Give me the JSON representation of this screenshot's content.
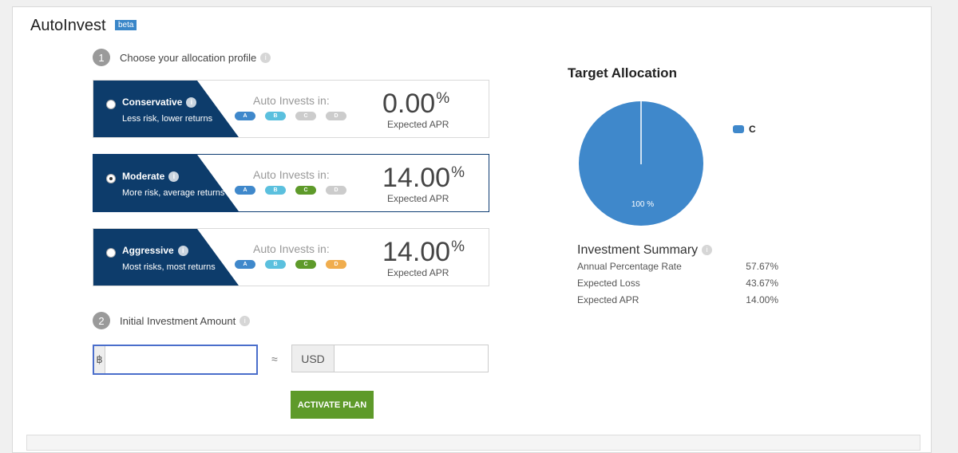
{
  "header": {
    "title": "AutoInvest",
    "badge": "beta"
  },
  "step1": {
    "num": "1",
    "label": "Choose your allocation profile"
  },
  "profiles": [
    {
      "name": "Conservative",
      "desc": "Less risk, lower returns",
      "selected": false,
      "auto_label": "Auto Invests in:",
      "pills": [
        "A",
        "B",
        "C",
        "D"
      ],
      "pct": "0.00",
      "pct_sym": "%",
      "apr_label": "Expected APR"
    },
    {
      "name": "Moderate",
      "desc": "More risk, average returns",
      "selected": true,
      "auto_label": "Auto Invests in:",
      "pills": [
        "A",
        "B",
        "C",
        "D"
      ],
      "pct": "14.00",
      "pct_sym": "%",
      "apr_label": "Expected APR"
    },
    {
      "name": "Aggressive",
      "desc": "Most risks, most returns",
      "selected": false,
      "auto_label": "Auto Invests in:",
      "pills": [
        "A",
        "B",
        "C",
        "D"
      ],
      "pct": "14.00",
      "pct_sym": "%",
      "apr_label": "Expected APR"
    }
  ],
  "pill_colors": {
    "active": {
      "A": "#3f88cb",
      "B": "#5bc0de",
      "C": "#5e9a2a",
      "D": "#f0ad4e"
    },
    "inactive": "#cccccc"
  },
  "pill_active": [
    [
      true,
      true,
      false,
      false
    ],
    [
      true,
      true,
      true,
      false
    ],
    [
      true,
      true,
      true,
      true
    ]
  ],
  "step2": {
    "num": "2",
    "label": "Initial Investment Amount"
  },
  "amount": {
    "btc_symbol": "฿",
    "btc_value": "",
    "approx": "≈",
    "usd_label": "USD",
    "usd_value": ""
  },
  "activate_label": "ACTIVATE PLAN",
  "target": {
    "title": "Target Allocation",
    "legend": "C",
    "slice_label": "100 %",
    "color": "#3f88cb"
  },
  "summary": {
    "title": "Investment Summary",
    "rows": [
      {
        "label": "Annual Percentage Rate",
        "value": "57.67%"
      },
      {
        "label": "Expected Loss",
        "value": "43.67%"
      },
      {
        "label": "Expected APR",
        "value": "14.00%"
      }
    ]
  }
}
